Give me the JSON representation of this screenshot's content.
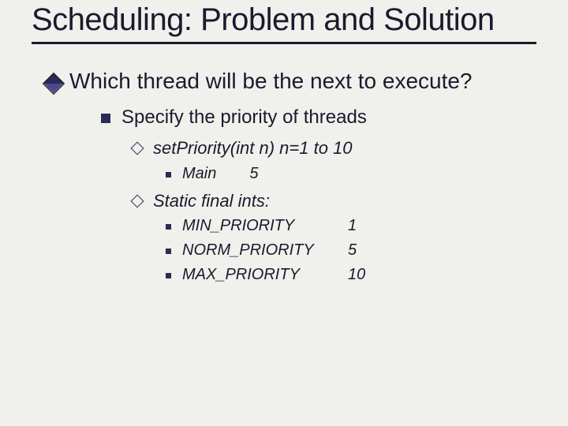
{
  "title": "Scheduling: Problem and Solution",
  "level1": {
    "text": "Which thread will be the next to execute?"
  },
  "level2": {
    "text": "Specify the priority of threads"
  },
  "level3a": {
    "text": "setPriority(int n)  n=1 to 10"
  },
  "level4a": {
    "label": "Main",
    "value": "5"
  },
  "level3b": {
    "text": "Static final ints:"
  },
  "constants": [
    {
      "label": "MIN_PRIORITY",
      "value": "1"
    },
    {
      "label": "NORM_PRIORITY",
      "value": "5"
    },
    {
      "label": "MAX_PRIORITY",
      "value": "10"
    }
  ]
}
